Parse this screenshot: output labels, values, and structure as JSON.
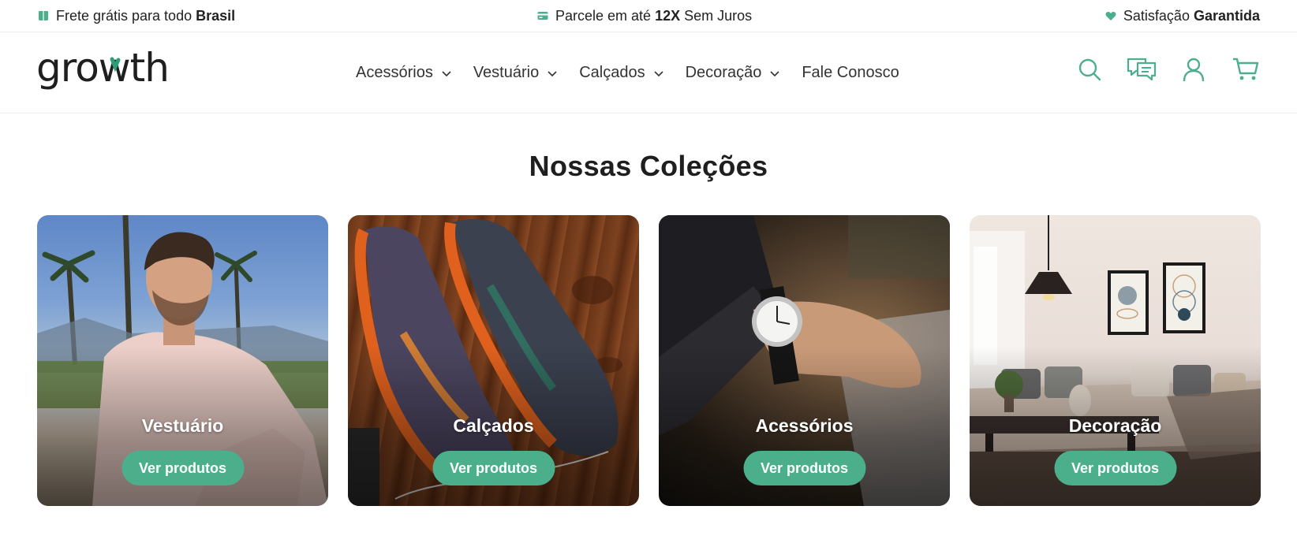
{
  "topbar": {
    "shipping": {
      "text": "Frete grátis para todo ",
      "bold": "Brasil",
      "icon": "package-icon"
    },
    "installments": {
      "text": "Parcele em até ",
      "bold": "12X",
      "suffix": " Sem Juros",
      "icon": "credit-card-icon"
    },
    "satisfaction": {
      "text": "Satisfação ",
      "bold": "Garantida",
      "icon": "heart-icon"
    }
  },
  "header": {
    "logo_text": "growth",
    "nav": [
      {
        "label": "Acessórios",
        "has_dropdown": true
      },
      {
        "label": "Vestuário",
        "has_dropdown": true
      },
      {
        "label": "Calçados",
        "has_dropdown": true
      },
      {
        "label": "Decoração",
        "has_dropdown": true
      },
      {
        "label": "Fale Conosco",
        "has_dropdown": false
      }
    ],
    "icons": [
      "search-icon",
      "chat-icon",
      "user-icon",
      "cart-icon"
    ]
  },
  "main": {
    "title": "Nossas Coleções",
    "collections": [
      {
        "title": "Vestuário",
        "button": "Ver produtos"
      },
      {
        "title": "Calçados",
        "button": "Ver produtos"
      },
      {
        "title": "Acessórios",
        "button": "Ver produtos"
      },
      {
        "title": "Decoração",
        "button": "Ver produtos"
      }
    ]
  },
  "colors": {
    "accent": "#4caf8c",
    "text": "#222222",
    "border": "#ececec"
  }
}
